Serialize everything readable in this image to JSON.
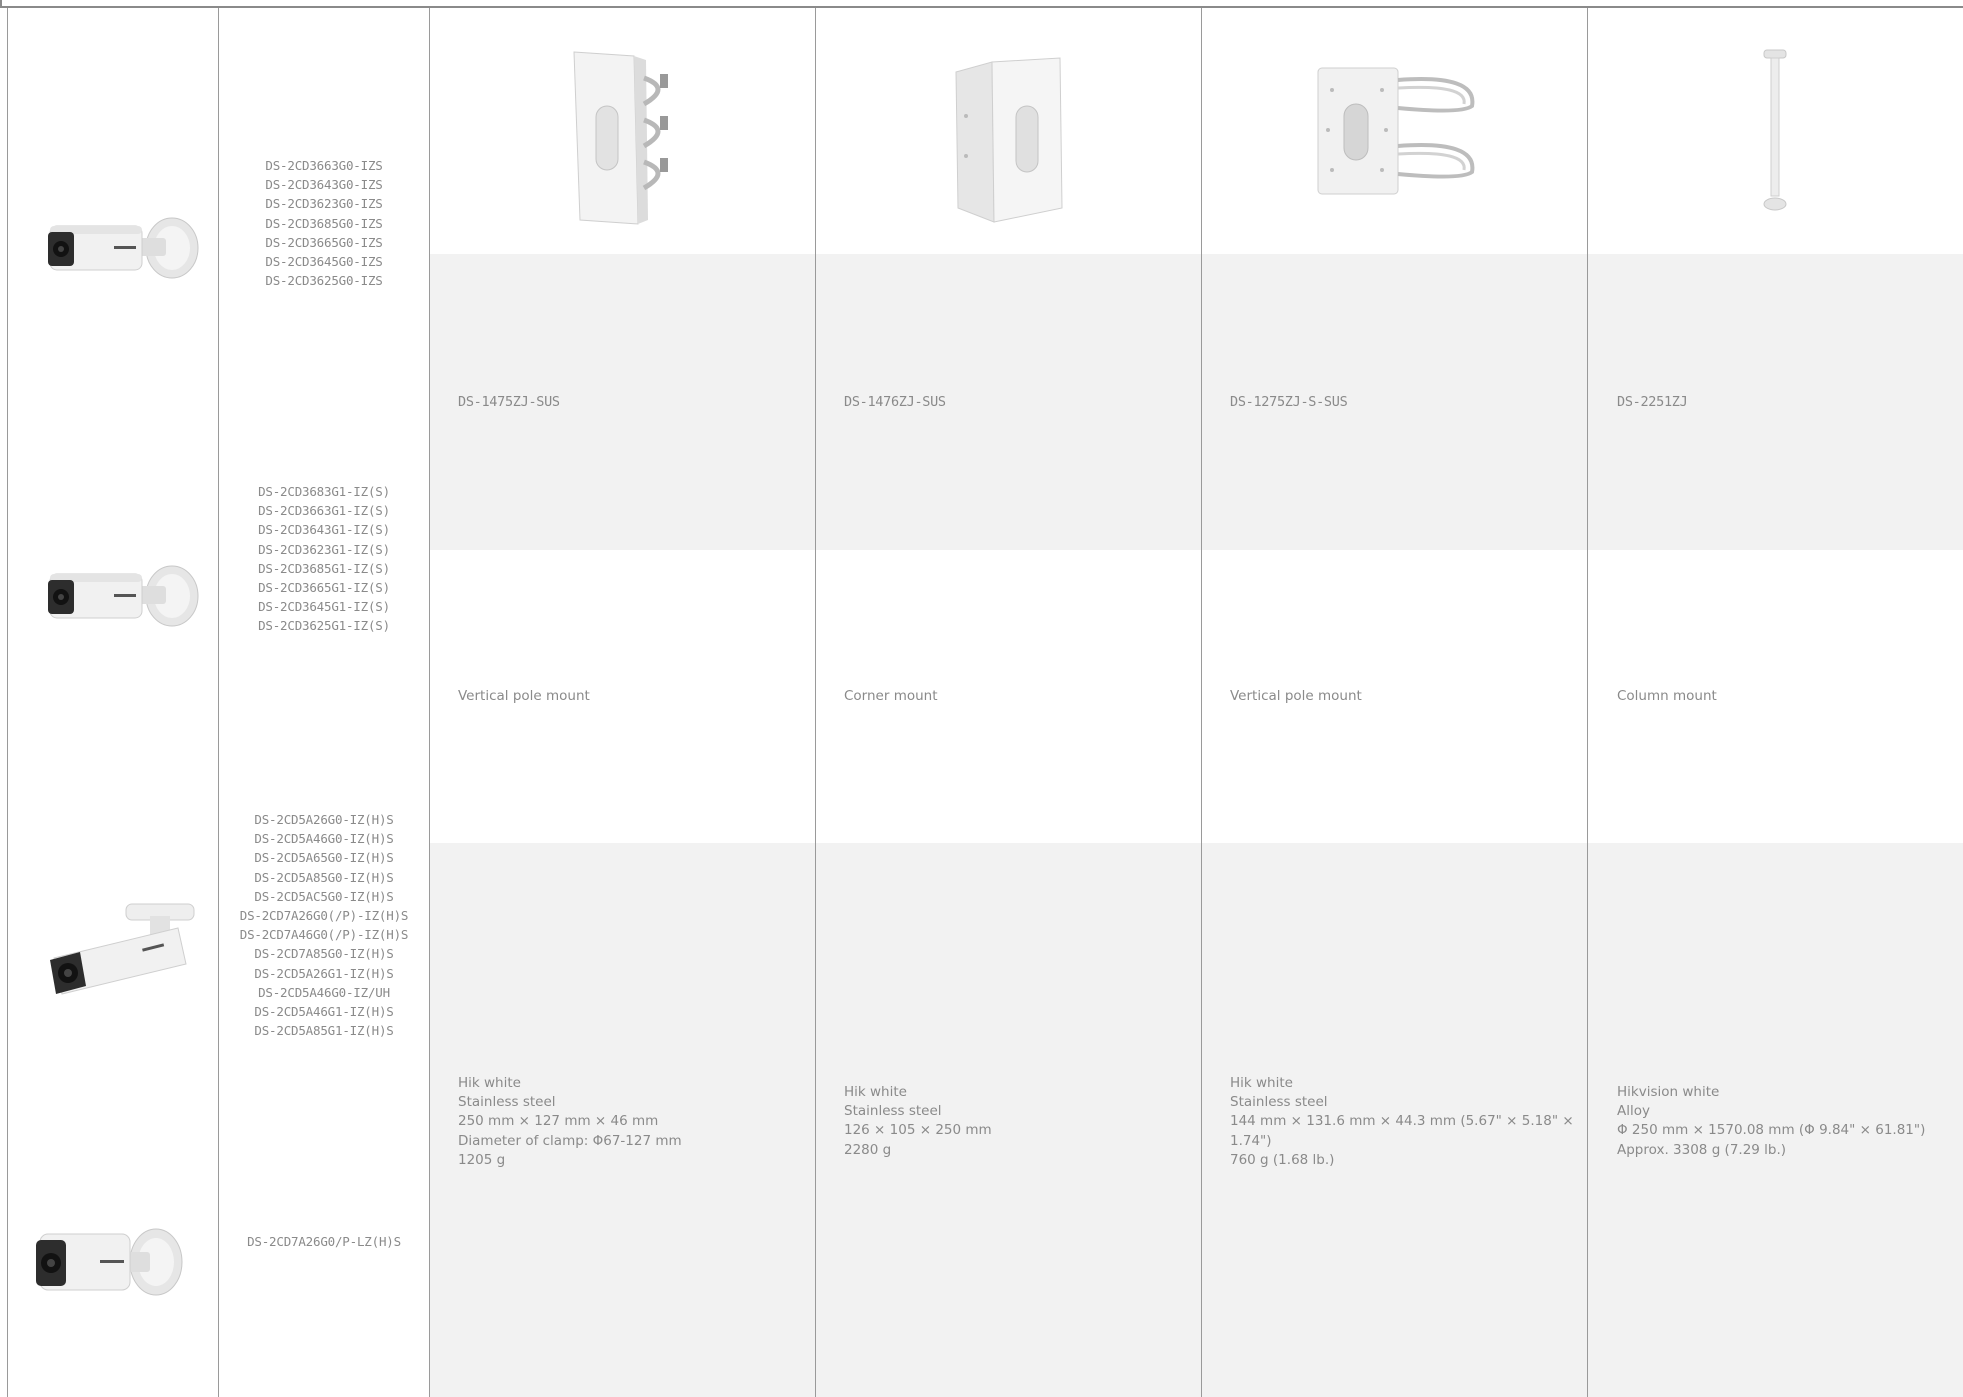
{
  "camera_groups": [
    {
      "models": [
        "DS-2CD3663G0-IZS",
        "DS-2CD3643G0-IZS",
        "DS-2CD3623G0-IZS",
        "DS-2CD3685G0-IZS",
        "DS-2CD3665G0-IZS",
        "DS-2CD3645G0-IZS",
        "DS-2CD3625G0-IZS"
      ]
    },
    {
      "models": [
        "DS-2CD3683G1-IZ(S)",
        "DS-2CD3663G1-IZ(S)",
        "DS-2CD3643G1-IZ(S)",
        "DS-2CD3623G1-IZ(S)",
        "DS-2CD3685G1-IZ(S)",
        "DS-2CD3665G1-IZ(S)",
        "DS-2CD3645G1-IZ(S)",
        "DS-2CD3625G1-IZ(S)"
      ]
    },
    {
      "models": [
        "DS-2CD5A26G0-IZ(H)S",
        "DS-2CD5A46G0-IZ(H)S",
        "DS-2CD5A65G0-IZ(H)S",
        "DS-2CD5A85G0-IZ(H)S",
        "DS-2CD5AC5G0-IZ(H)S",
        "DS-2CD7A26G0(/P)-IZ(H)S",
        "DS-2CD7A46G0(/P)-IZ(H)S",
        "DS-2CD7A85G0-IZ(H)S",
        "DS-2CD5A26G1-IZ(H)S",
        "DS-2CD5A46G0-IZ/UH",
        "DS-2CD5A46G1-IZ(H)S",
        "DS-2CD5A85G1-IZ(H)S"
      ]
    },
    {
      "models": [
        "DS-2CD7A26G0/P-LZ(H)S"
      ]
    }
  ],
  "mounts": [
    {
      "icon": "vertical-pole-mount-image",
      "model": "DS-1475ZJ-SUS",
      "type": "Vertical pole mount",
      "specs": [
        "Hik white",
        "Stainless steel",
        "250 mm × 127 mm × 46 mm",
        "Diameter of clamp: Φ67-127 mm",
        "1205 g"
      ]
    },
    {
      "icon": "corner-mount-image",
      "model": "DS-1476ZJ-SUS",
      "type": "Corner mount",
      "specs": [
        "Hik white",
        "Stainless steel",
        "126 × 105 × 250 mm",
        "2280 g"
      ]
    },
    {
      "icon": "clamp-pole-mount-image",
      "model": "DS-1275ZJ-S-SUS",
      "type": "Vertical pole mount",
      "specs": [
        "Hik white",
        "Stainless steel",
        "144 mm × 131.6 mm × 44.3 mm (5.67\" × 5.18\" ×",
        "1.74\")",
        "760 g (1.68 lb.)"
      ]
    },
    {
      "icon": "column-mount-image",
      "model": "DS-2251ZJ",
      "type": "Column mount",
      "specs": [
        "Hikvision white",
        "Alloy",
        "Φ 250 mm × 1570.08 mm (Φ 9.84\" × 61.81\")",
        "Approx. 3308 g (7.29 lb.)"
      ]
    }
  ],
  "colors": {
    "band": "#f2f2f2",
    "rule": "#9a9a9a",
    "text": "#8a8a8a"
  }
}
